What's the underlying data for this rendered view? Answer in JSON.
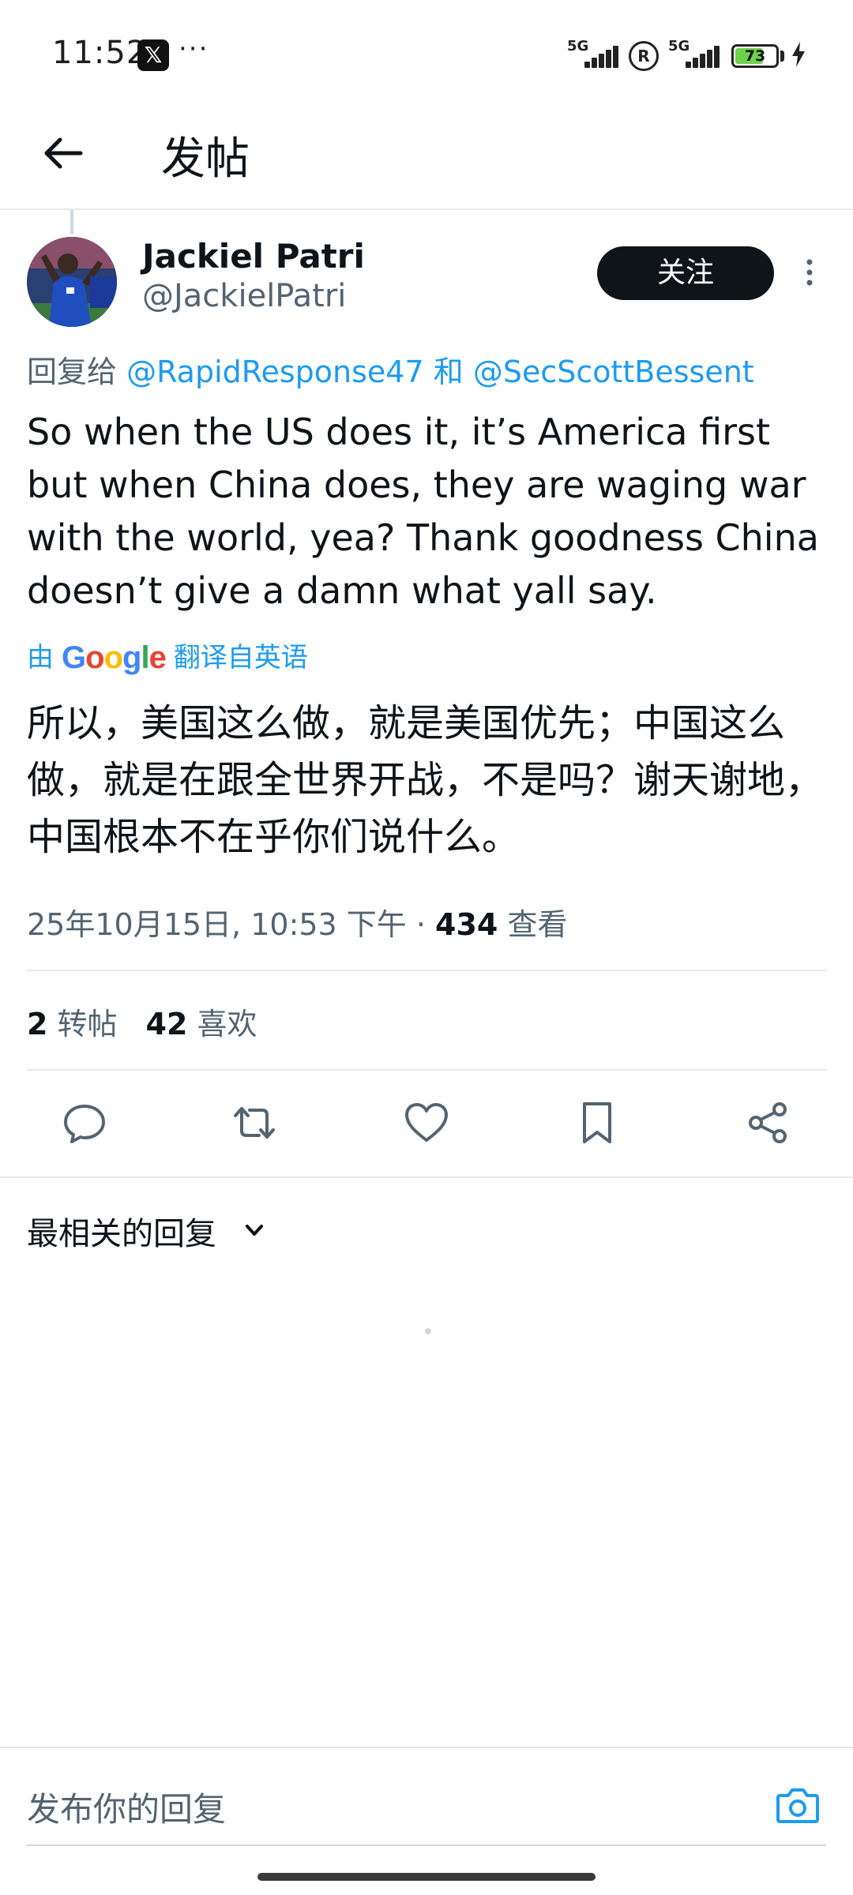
{
  "status_bar": {
    "time": "11:52",
    "x_glyph": "𝕏",
    "more": "···",
    "signal1_label": "5G",
    "signal2_label": "5G",
    "reg_symbol": "R",
    "battery_level": 73,
    "battery_text": "73"
  },
  "header": {
    "title": "发帖",
    "back_icon": "arrow-left-icon"
  },
  "post": {
    "author_name": "Jackiel Patri",
    "author_handle": "@JackielPatri",
    "follow_label": "关注",
    "reply_prefix": "回复给",
    "reply_mention_1": "@RapidResponse47",
    "reply_conjunction": "和",
    "reply_mention_2": "@SecScottBessent",
    "text": "So when the US does it, it’s America first but when China does, they are waging war with the world, yea? Thank goodness China doesn’t give a damn what yall say.",
    "translate_prefix": "由",
    "translate_brand": "Google",
    "translate_suffix": "翻译自英语",
    "translated_text": "所以，美国这么做，就是美国优先；中国这么做，就是在跟全世界开战，不是吗？谢天谢地，中国根本不在乎你们说什么。",
    "timestamp": "25年10月15日, 10:53 下午 · ",
    "views_count": "434",
    "views_label": " 查看",
    "reposts_count": "2",
    "reposts_label": " 转帖",
    "likes_count": "42",
    "likes_label": " 喜欢"
  },
  "actions": [
    "reply-icon",
    "repost-icon",
    "like-icon",
    "bookmark-icon",
    "share-icon"
  ],
  "replies": {
    "sort_label": "最相关的回复"
  },
  "compose": {
    "placeholder": "发布你的回复",
    "camera_icon": "camera-icon"
  },
  "colors": {
    "accent": "#1d9bf0",
    "text_primary": "#0f1419",
    "text_secondary": "#536471",
    "button_dark": "#0f1419"
  }
}
